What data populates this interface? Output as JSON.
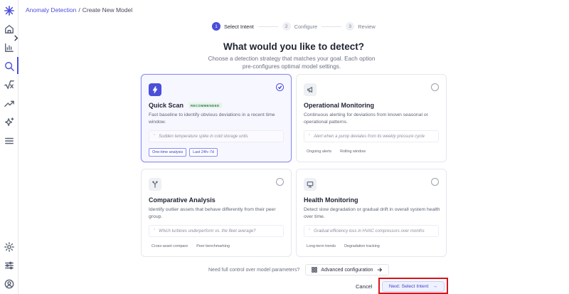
{
  "breadcrumb": {
    "parent": "Anomaly Detection",
    "separator": "/",
    "current": "Create New Model"
  },
  "stepper": [
    {
      "num": "1",
      "label": "Select Intent"
    },
    {
      "num": "2",
      "label": "Configure"
    },
    {
      "num": "3",
      "label": "Review"
    }
  ],
  "heading": "What would you like to detect?",
  "subheading": "Choose a detection strategy that matches your goal. Each option pre-configures optimal model settings.",
  "cards": [
    {
      "title": "Quick Scan",
      "badge": "RECOMMENDED",
      "desc": "Fast baseline to identify obvious deviations in a recent time window.",
      "example": "Sudden temperature spike in cold storage units",
      "tags": [
        "One-time analysis",
        "Last 24h–7d"
      ]
    },
    {
      "title": "Operational Monitoring",
      "desc": "Continuous alerting for deviations from known seasonal or operational patterns.",
      "example": "Alert when a pump deviates from its weekly pressure cycle",
      "tags": [
        "Ongoing alerts",
        "Rolling window"
      ]
    },
    {
      "title": "Comparative Analysis",
      "desc": "Identify outlier assets that behave differently from their peer group.",
      "example": "Which turbines underperform vs. the fleet average?",
      "tags": [
        "Cross-asset compare",
        "Peer benchmarking"
      ]
    },
    {
      "title": "Health Monitoring",
      "desc": "Detect slow degradation or gradual drift in overall system health over time.",
      "example": "Gradual efficiency loss in HVAC compressors over months",
      "tags": [
        "Long-term trends",
        "Degradation tracking"
      ]
    }
  ],
  "quote_glyph": "”",
  "footer": {
    "adv_prompt": "Need full control over model parameters?",
    "adv_label": "Advanced configuration",
    "cancel_label": "Cancel",
    "next_label": "Next: Select Intent",
    "next_arrow": "→"
  },
  "colors": {
    "accent": "#4b4fd9",
    "highlight": "#d9141c",
    "badge_bg": "#e6f4ea",
    "badge_text": "#2d7a4b"
  }
}
